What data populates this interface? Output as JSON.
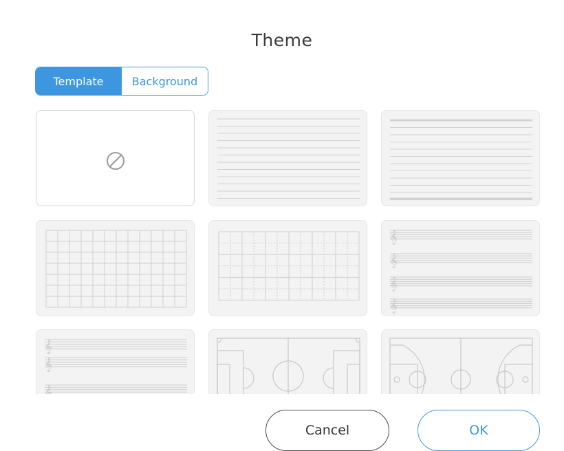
{
  "dialog": {
    "title": "Theme",
    "tabs": [
      {
        "label": "Template",
        "active": true
      },
      {
        "label": "Background",
        "active": false
      }
    ],
    "templates": [
      {
        "name": "none",
        "selected": true
      },
      {
        "name": "lined-thin"
      },
      {
        "name": "lined-thick"
      },
      {
        "name": "grid"
      },
      {
        "name": "dotted-grid"
      },
      {
        "name": "music-staff"
      },
      {
        "name": "piano-staff"
      },
      {
        "name": "soccer-field"
      },
      {
        "name": "basketball-court"
      }
    ],
    "cancel_label": "Cancel",
    "ok_label": "OK"
  },
  "colors": {
    "accent": "#3d97e0",
    "tile_bg": "#f3f3f3",
    "line": "#d6d6d6"
  }
}
